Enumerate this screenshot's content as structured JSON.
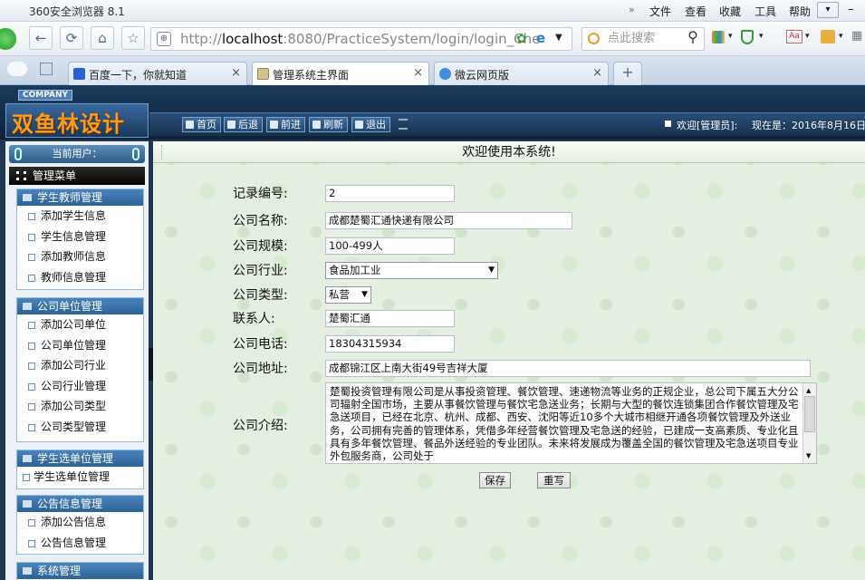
{
  "browser": {
    "title": "360安全浏览器 8.1",
    "menu": [
      "文件",
      "查看",
      "收藏",
      "工具",
      "帮助"
    ],
    "url_host": "localhost",
    "url_rest": ":8080/PracticeSystem/login/login_Che",
    "search_placeholder": "点此搜索",
    "tabs": [
      {
        "label": "百度一下，你就知道"
      },
      {
        "label": "管理系统主界面"
      },
      {
        "label": "微云网页版"
      }
    ],
    "new_tab": "+"
  },
  "app": {
    "company_tag": "COMPANY",
    "logo_text": "双鱼林设计",
    "nav": [
      "首页",
      "后退",
      "前进",
      "刷新",
      "退出"
    ],
    "welcome_user": "欢迎[管理员]:",
    "date_text": "现在是：2016年8月16日",
    "current_user_label": "当前用户：",
    "menu_title": "管理菜单",
    "groups": [
      {
        "title": "学生教师管理",
        "items": [
          "添加学生信息",
          "学生信息管理",
          "添加教师信息",
          "教师信息管理"
        ]
      },
      {
        "title": "公司单位管理",
        "items": [
          "添加公司单位",
          "公司单位管理",
          "添加公司行业",
          "公司行业管理",
          "添加公司类型",
          "公司类型管理"
        ]
      },
      {
        "title": "学生选单位管理",
        "items": [
          "学生选单位管理"
        ]
      },
      {
        "title": "公告信息管理",
        "items": [
          "添加公告信息",
          "公告信息管理"
        ]
      },
      {
        "title": "系统管理",
        "items": []
      }
    ]
  },
  "form": {
    "welcome": "欢迎使用本系统!",
    "record_label": "记录编号:",
    "record_value": "2",
    "name_label": "公司名称:",
    "name_value": "成都楚蜀汇通快递有限公司",
    "scale_label": "公司规模:",
    "scale_value": "100-499人",
    "industry_label": "公司行业:",
    "industry_value": "食品加工业",
    "type_label": "公司类型:",
    "type_value": "私营",
    "contact_label": "联系人:",
    "contact_value": "楚蜀汇通",
    "phone_label": "公司电话:",
    "phone_value": "18304315934",
    "address_label": "公司地址:",
    "address_value": "成都锦江区上南大街49号吉祥大厦",
    "intro_label": "公司介绍:",
    "intro_value": "楚蜀投资管理有限公司是从事投资管理、餐饮管理、速递物流等业务的正规企业，总公司下属五大分公司辐射全国市场，主要从事餐饮管理与餐饮宅急送业务；长期与大型的餐饮连锁集团合作餐饮管理及宅急送项目，已经在北京、杭州、成都、西安、沈阳等近10多个大城市相继开通各项餐饮管理及外送业务，公司拥有完善的管理体系，凭借多年经营餐饮管理及宅急送的经验，已建成一支高素质、专业化且具有多年餐饮管理、餐品外送经验的专业团队。未来将发展成为覆盖全国的餐饮管理及宅急送项目专业外包服务商，公司处于",
    "save_label": "保存",
    "reset_label": "重写"
  }
}
